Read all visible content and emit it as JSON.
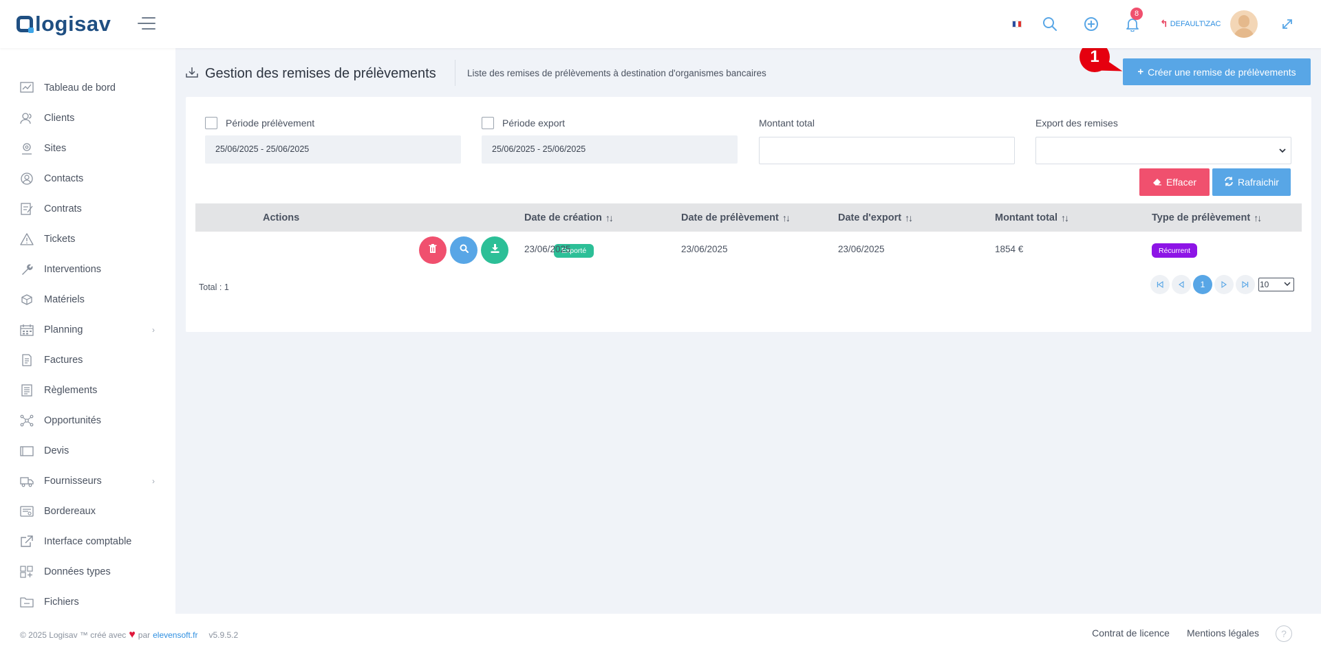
{
  "app": {
    "logo_text": "logisav"
  },
  "topbar": {
    "notification_count": "8",
    "user": "DEFAULT\\ZAC"
  },
  "sidebar": {
    "items": [
      {
        "label": "Tableau de bord",
        "icon": "chart-icon"
      },
      {
        "label": "Clients",
        "icon": "users-icon"
      },
      {
        "label": "Sites",
        "icon": "location-pin-icon"
      },
      {
        "label": "Contacts",
        "icon": "contacts-icon"
      },
      {
        "label": "Contrats",
        "icon": "contract-icon"
      },
      {
        "label": "Tickets",
        "icon": "warning-icon"
      },
      {
        "label": "Interventions",
        "icon": "wrench-icon"
      },
      {
        "label": "Matériels",
        "icon": "box-icon"
      },
      {
        "label": "Planning",
        "icon": "calendar-icon",
        "has_submenu": true
      },
      {
        "label": "Factures",
        "icon": "invoice-icon"
      },
      {
        "label": "Règlements",
        "icon": "payments-icon"
      },
      {
        "label": "Opportunités",
        "icon": "network-icon"
      },
      {
        "label": "Devis",
        "icon": "quote-icon"
      },
      {
        "label": "Fournisseurs",
        "icon": "truck-icon",
        "has_submenu": true
      },
      {
        "label": "Bordereaux",
        "icon": "slip-icon"
      },
      {
        "label": "Interface comptable",
        "icon": "external-link-icon"
      },
      {
        "label": "Données types",
        "icon": "grid-icon"
      },
      {
        "label": "Fichiers",
        "icon": "folder-icon"
      }
    ]
  },
  "page": {
    "title": "Gestion des remises de prélèvements",
    "subtitle": "Liste des remises de prélèvements à destination d'organismes bancaires",
    "create_button": "Créer une remise de prélèvements",
    "marker_number": "1"
  },
  "filters": {
    "periode_prelevement": {
      "label": "Période prélèvement",
      "value": "25/06/2025 - 25/06/2025",
      "checked": false
    },
    "periode_export": {
      "label": "Période export",
      "value": "25/06/2025 - 25/06/2025",
      "checked": false
    },
    "montant_total": {
      "label": "Montant total",
      "value": ""
    },
    "export_remises": {
      "label": "Export des remises",
      "value": ""
    },
    "clear_button": "Effacer",
    "refresh_button": "Rafraichir"
  },
  "table": {
    "columns": [
      "Actions",
      "Date de création",
      "Date de prélèvement",
      "Date d'export",
      "Montant total",
      "Type de prélèvement"
    ],
    "rows": [
      {
        "status": "Exporté",
        "date_creation": "23/06/2025",
        "date_prelevement": "23/06/2025",
        "date_export": "23/06/2025",
        "montant": "1854 €",
        "type": "Récurrent"
      }
    ],
    "total_label": "Total : 1",
    "current_page": "1",
    "page_size": "10"
  },
  "footer": {
    "copyright": "© 2025 Logisav ™ créé avec",
    "by": "par",
    "company_link": "elevensoft.fr",
    "version": "v5.9.5.2",
    "license_link": "Contrat de licence",
    "legal_link": "Mentions légales",
    "help": "?"
  },
  "colors": {
    "primary": "#58a6e6",
    "danger": "#f0506e",
    "success": "#2cbf97",
    "purple": "#8d14e6",
    "brand": "#1f4f82"
  }
}
